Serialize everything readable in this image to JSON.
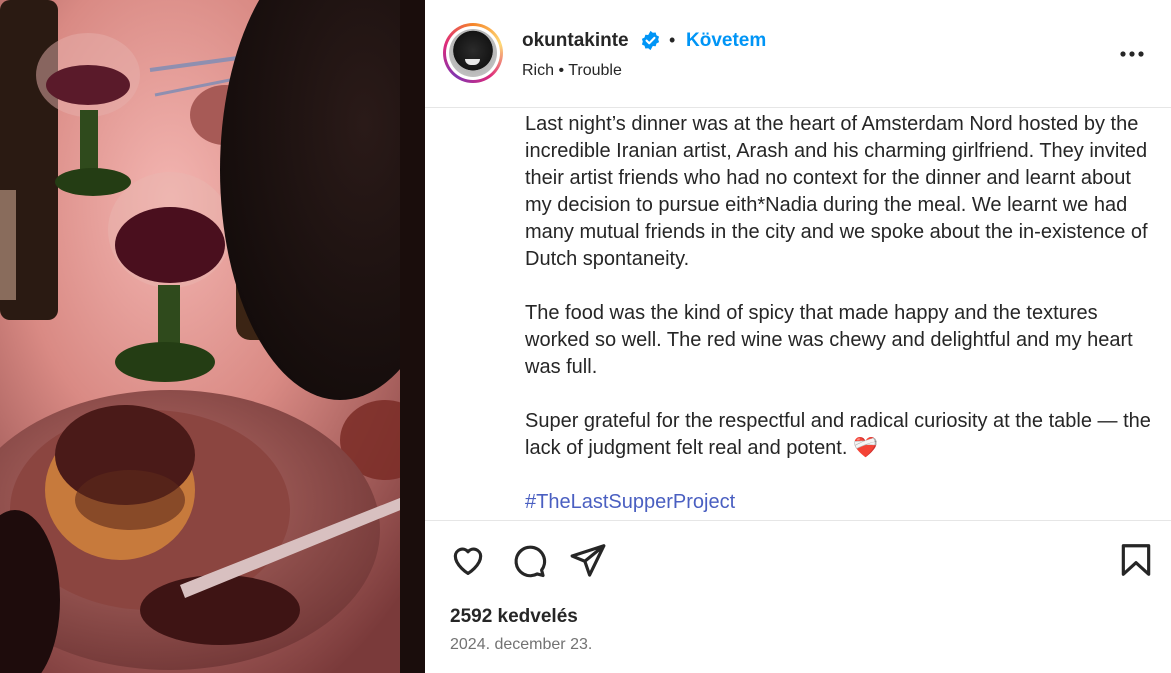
{
  "post": {
    "username": "okuntakinte",
    "separator": "•",
    "follow_label": "Követem",
    "audio_line": "Rich • Trouble",
    "caption": {
      "p1": "Last night’s dinner was at the heart of Amsterdam Nord hosted by the incredible Iranian artist, Arash and his charming girlfriend. They invited their artist friends who had no context for the dinner and learnt about my decision to pursue eith*Nadia during the meal. We learnt we had many mutual friends in the city and we spoke about the in-existence of Dutch spontaneity.",
      "p2": "The food was the kind of spicy that made happy and the textures worked so well. The red wine was chewy and delightful and my heart was full.",
      "p3": "Super grateful for the respectful and radical curiosity at the table — the lack of judgment felt real and potent. ❤️‍🩹",
      "hashtag": "#TheLastSupperProject"
    },
    "likes": "2592 kedvelés",
    "date": "2024. december 23."
  },
  "icons": {
    "verified": "verified-badge-icon",
    "more": "more-options-icon",
    "like": "heart-icon",
    "comment": "comment-icon",
    "share": "share-icon",
    "save": "bookmark-icon"
  },
  "colors": {
    "follow": "#0095f6",
    "verified": "#0095f6",
    "hashtag": "#4a5fc1",
    "muted": "#737373"
  }
}
